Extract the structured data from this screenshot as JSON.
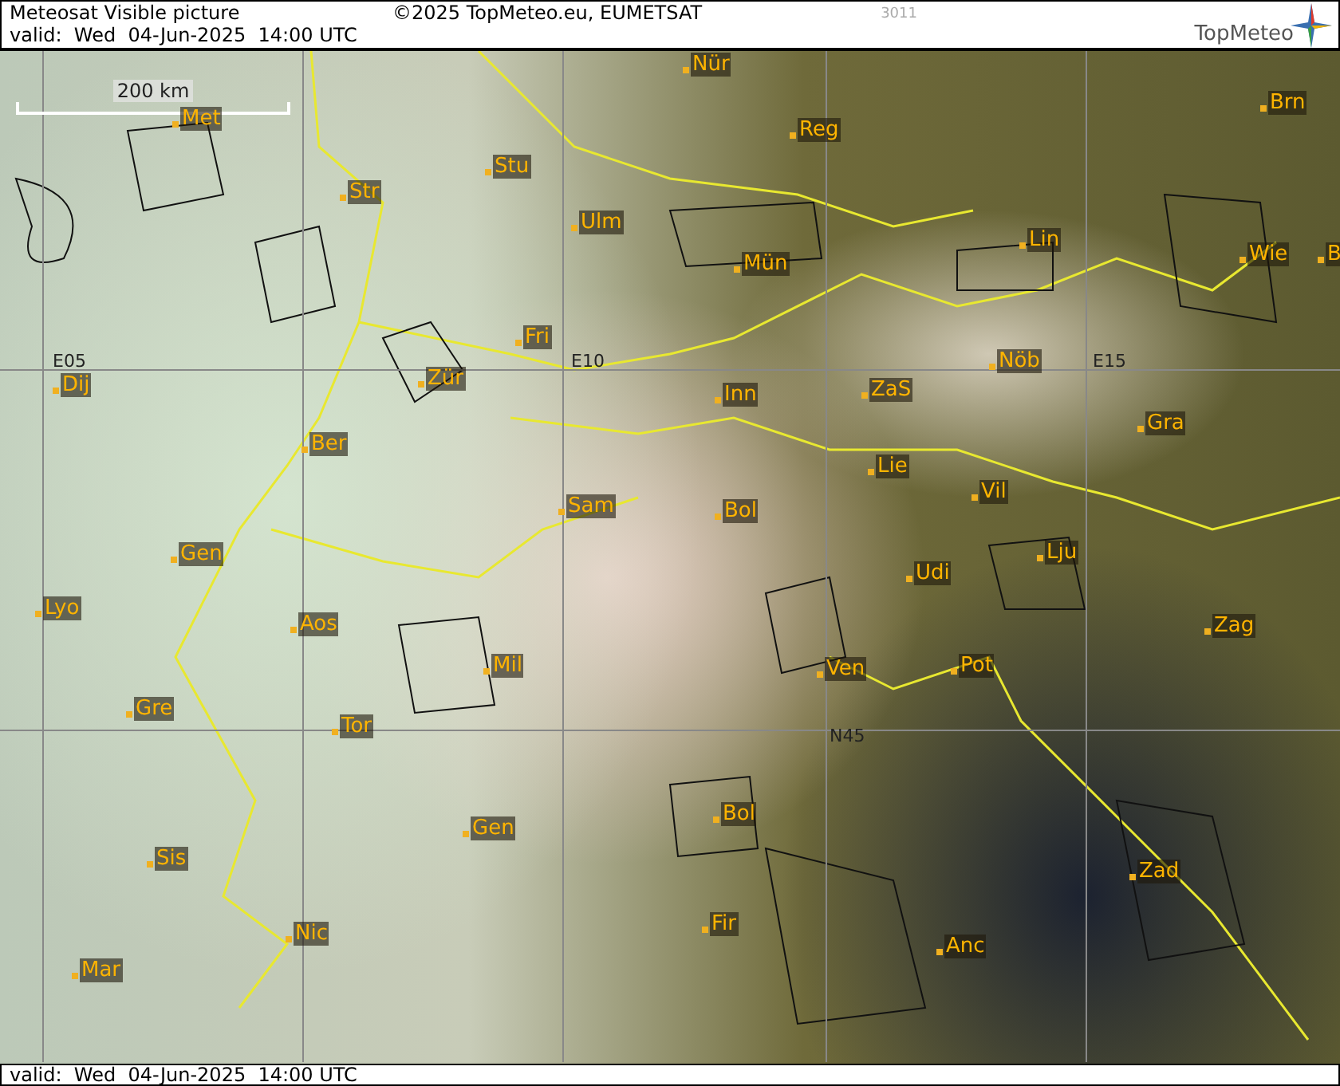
{
  "header": {
    "title": "Meteosat Visible picture",
    "copyright": "©2025 TopMeteo.eu, EUMETSAT",
    "code": "3011",
    "valid": "valid:  Wed  04-Jun-2025  14:00 UTC"
  },
  "logo": {
    "text": "TopMeteo"
  },
  "scale_bar": {
    "label": "200 km"
  },
  "grid_labels": [
    "E05",
    "E10",
    "E15",
    "N45"
  ],
  "places": [
    {
      "name": "Met"
    },
    {
      "name": "Str"
    },
    {
      "name": "Stu"
    },
    {
      "name": "Ulm"
    },
    {
      "name": "Nür"
    },
    {
      "name": "Reg"
    },
    {
      "name": "Mün"
    },
    {
      "name": "Lin"
    },
    {
      "name": "Brn"
    },
    {
      "name": "Wie"
    },
    {
      "name": "B"
    },
    {
      "name": "Fri"
    },
    {
      "name": "Zür"
    },
    {
      "name": "Inn"
    },
    {
      "name": "ZaS"
    },
    {
      "name": "Nöb"
    },
    {
      "name": "Dij"
    },
    {
      "name": "Ber"
    },
    {
      "name": "Gra"
    },
    {
      "name": "Lie"
    },
    {
      "name": "Sam"
    },
    {
      "name": "Bol"
    },
    {
      "name": "Vil"
    },
    {
      "name": "Gen"
    },
    {
      "name": "Lju"
    },
    {
      "name": "Udi"
    },
    {
      "name": "Lyo"
    },
    {
      "name": "Aos"
    },
    {
      "name": "Zag"
    },
    {
      "name": "Mil"
    },
    {
      "name": "Ven"
    },
    {
      "name": "Pot"
    },
    {
      "name": "Gre"
    },
    {
      "name": "Tor"
    },
    {
      "name": "Bol"
    },
    {
      "name": "Gen"
    },
    {
      "name": "Zad"
    },
    {
      "name": "Sis"
    },
    {
      "name": "Nic"
    },
    {
      "name": "Fir"
    },
    {
      "name": "Anc"
    },
    {
      "name": "Mar"
    }
  ],
  "footer": {
    "valid": "valid:  Wed  04-Jun-2025  14:00 UTC"
  }
}
